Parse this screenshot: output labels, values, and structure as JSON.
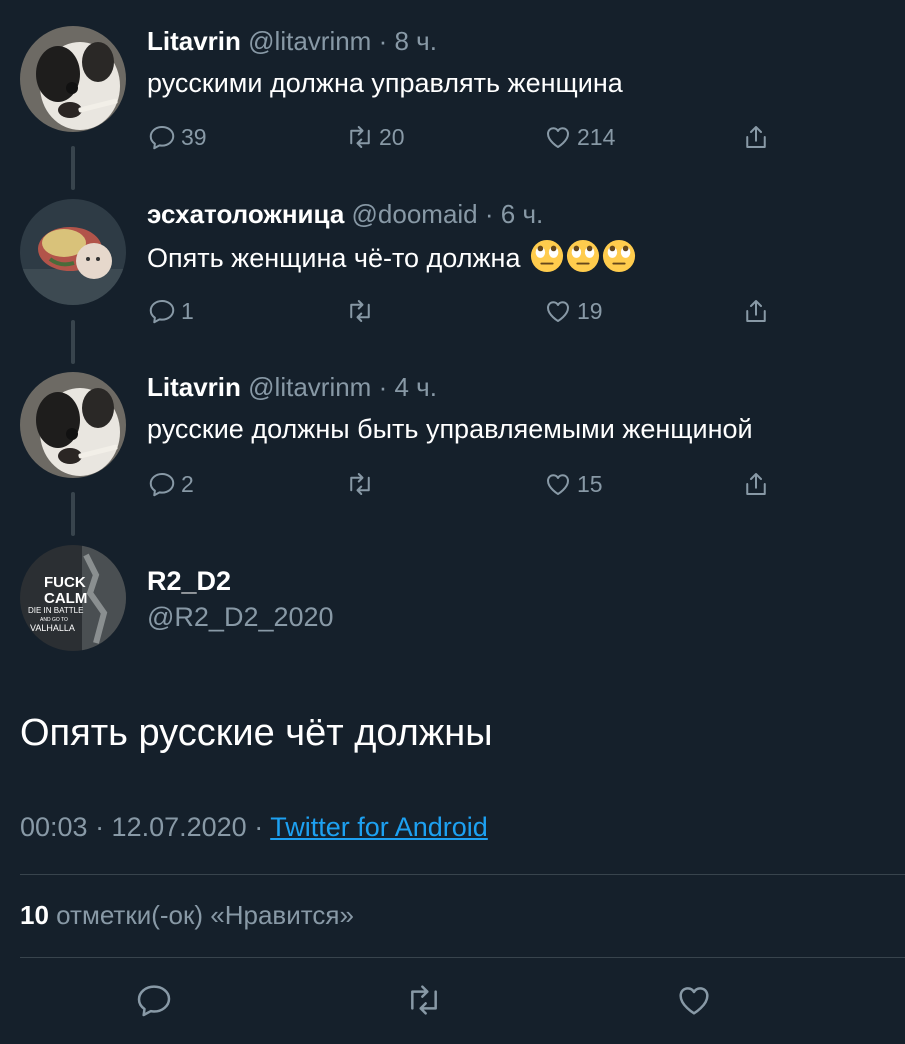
{
  "thread": [
    {
      "name": "Litavrin",
      "handle": "@litavrinm",
      "time": "· 8 ч.",
      "text": "русскими должна управлять женщина",
      "replies": "39",
      "retweets": "20",
      "likes": "214",
      "avatar": "dog-avatar"
    },
    {
      "name": "эсхатоложница",
      "handle": "@doomaid",
      "time": "· 6 ч.",
      "text": "Опять женщина чё-то должна",
      "emojis": [
        "eye-roll-emoji",
        "eye-roll-emoji",
        "eye-roll-emoji"
      ],
      "replies": "1",
      "retweets": "",
      "likes": "19",
      "avatar": "doll-avatar"
    },
    {
      "name": "Litavrin",
      "handle": "@litavrinm",
      "time": "· 4 ч.",
      "text": "русские должны быть управляемыми женщиной",
      "replies": "2",
      "retweets": "",
      "likes": "15",
      "avatar": "dog-avatar"
    }
  ],
  "main_tweet": {
    "name": "R2_D2",
    "handle": "@R2_D2_2020",
    "avatar_text": [
      "FUCK",
      "CALM",
      "DIE IN BATTLE",
      "AND GO TO",
      "VALHALLA"
    ],
    "text": "Опять русские чёт должны",
    "timestamp": "00:03 · 12.07.2020 ·",
    "source": "Twitter for Android",
    "like_count": "10",
    "like_label": "отметки(-ок) «Нравится»"
  },
  "colors": {
    "background": "#15202b",
    "secondary_text": "#8899a6",
    "link": "#1da1f2",
    "divider": "#38444d"
  }
}
